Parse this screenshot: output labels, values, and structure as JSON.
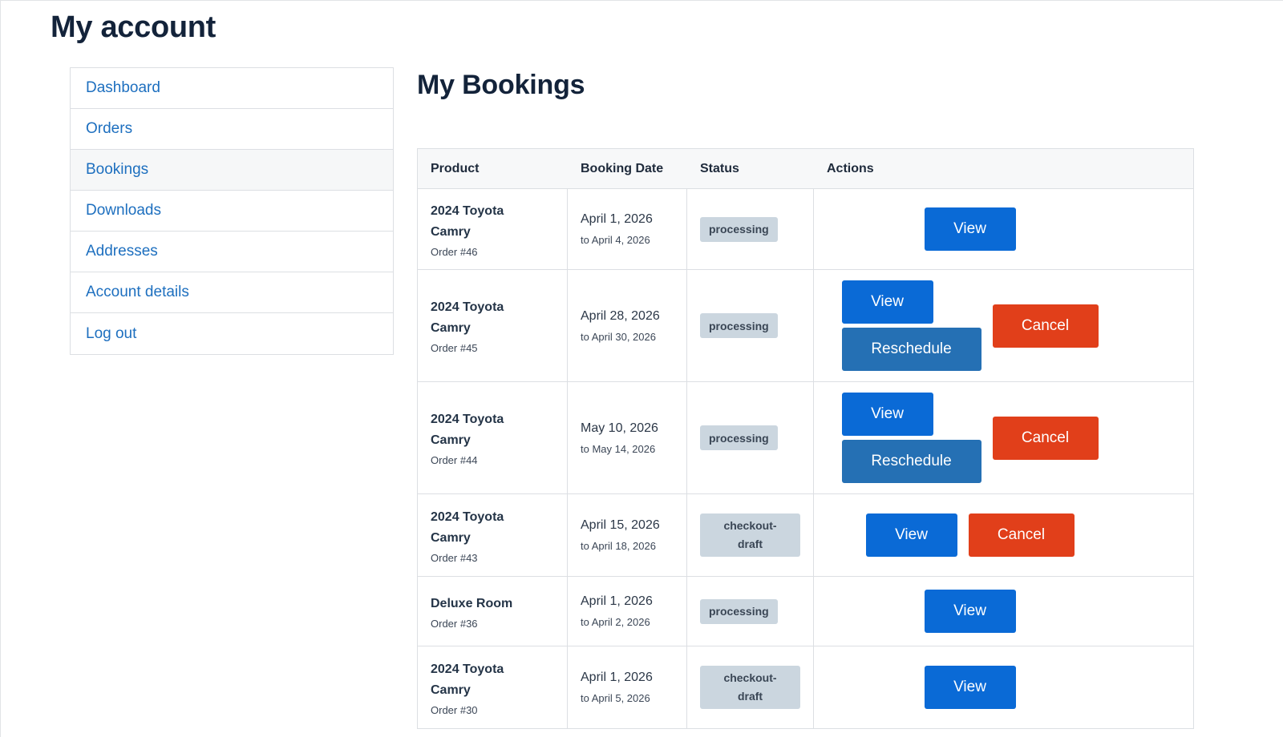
{
  "page": {
    "title": "My account"
  },
  "sidebar": {
    "items": [
      {
        "label": "Dashboard",
        "active": false
      },
      {
        "label": "Orders",
        "active": false
      },
      {
        "label": "Bookings",
        "active": true
      },
      {
        "label": "Downloads",
        "active": false
      },
      {
        "label": "Addresses",
        "active": false
      },
      {
        "label": "Account details",
        "active": false
      },
      {
        "label": "Log out",
        "active": false
      }
    ]
  },
  "bookings": {
    "title": "My Bookings",
    "columns": {
      "product": "Product",
      "date": "Booking Date",
      "status": "Status",
      "actions": "Actions"
    },
    "buttons": {
      "view": "View",
      "reschedule": "Reschedule",
      "cancel": "Cancel"
    },
    "rows": [
      {
        "product": "2024 Toyota Camry",
        "order": "Order #46",
        "date": "April 1, 2026",
        "date_to": "to April 4, 2026",
        "status": "processing"
      },
      {
        "product": "2024 Toyota Camry",
        "order": "Order #45",
        "date": "April 28, 2026",
        "date_to": "to April 30, 2026",
        "status": "processing"
      },
      {
        "product": "2024 Toyota Camry",
        "order": "Order #44",
        "date": "May 10, 2026",
        "date_to": "to May 14, 2026",
        "status": "processing"
      },
      {
        "product": "2024 Toyota Camry",
        "order": "Order #43",
        "date": "April 15, 2026",
        "date_to": "to April 18, 2026",
        "status": "checkout-draft"
      },
      {
        "product": "Deluxe Room",
        "order": "Order #36",
        "date": "April 1, 2026",
        "date_to": "to April 2, 2026",
        "status": "processing"
      },
      {
        "product": "2024 Toyota Camry",
        "order": "Order #30",
        "date": "April 1, 2026",
        "date_to": "to April 5, 2026",
        "status": "checkout-draft"
      }
    ]
  },
  "colors": {
    "link": "#1d6fbf",
    "view_button": "#0a6ad6",
    "reschedule_button": "#2570b4",
    "cancel_button": "#e13f1a",
    "status_badge": "#cbd6df"
  }
}
